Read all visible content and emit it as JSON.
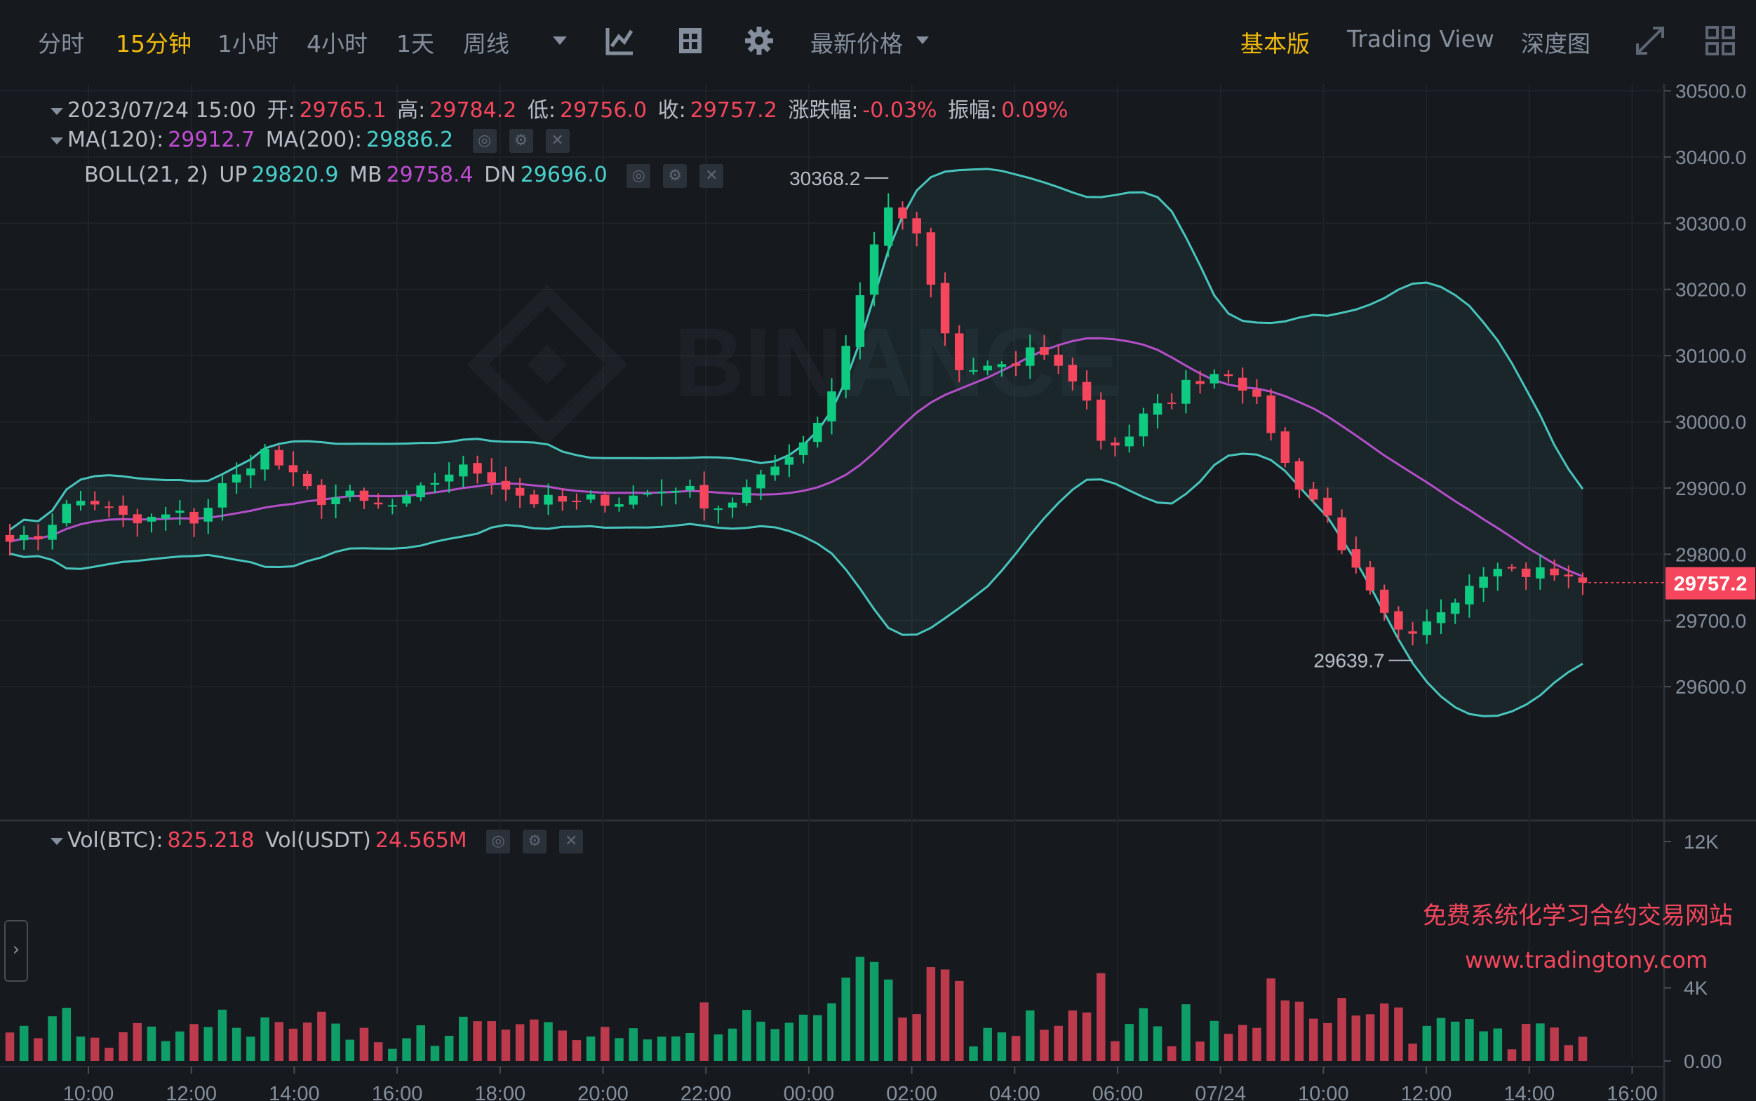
{
  "toolbar": {
    "intervals": [
      "分时",
      "15分钟",
      "1小时",
      "4小时",
      "1天",
      "周线"
    ],
    "active_interval": "15分钟",
    "price_type": "最新价格",
    "views": [
      "基本版",
      "Trading View",
      "深度图"
    ],
    "active_view": "基本版"
  },
  "legend": {
    "ohlc": {
      "time": "2023/07/24 15:00",
      "open_label": "开:",
      "open": "29765.1",
      "high_label": "高:",
      "high": "29784.2",
      "low_label": "低:",
      "low": "29756.0",
      "close_label": "收:",
      "close": "29757.2",
      "change_label": "涨跌幅:",
      "change": "-0.03%",
      "amp_label": "振幅:",
      "amp": "0.09%"
    },
    "ma": {
      "ma120_label": "MA(120):",
      "ma120": "29912.7",
      "ma200_label": "MA(200):",
      "ma200": "29886.2"
    },
    "boll": {
      "label": "BOLL(21, 2)",
      "up_label": "UP",
      "up": "29820.9",
      "mb_label": "MB",
      "mb": "29758.4",
      "dn_label": "DN",
      "dn": "29696.0"
    },
    "vol": {
      "btc_label": "Vol(BTC):",
      "btc": "825.218",
      "usdt_label": "Vol(USDT)",
      "usdt": "24.565M"
    }
  },
  "watermark": {
    "logo_text": "BINANCE",
    "line1": "免费系统化学习合约交易网站",
    "line2": "www.tradingtony.com"
  },
  "colors": {
    "up": "#0ecb81",
    "down": "#f6465d",
    "boll": "#48c5bd",
    "ma": "#b44fc9",
    "accent": "#f0b90b",
    "bg": "#161a1e"
  },
  "chart_data": {
    "type": "candlestick",
    "interval": "15m",
    "price_axis": {
      "ticks": [
        "30500.0",
        "30400.0",
        "30300.0",
        "30200.0",
        "30100.0",
        "30000.0",
        "29900.0",
        "29800.0",
        "29700.0",
        "29600.0"
      ],
      "ylim": [
        29525,
        30510
      ]
    },
    "volume_axis": {
      "ticks": [
        "12K",
        "4K",
        "0.00"
      ],
      "ylim": [
        0,
        12000
      ]
    },
    "time_axis": {
      "ticks": [
        "10:00",
        "12:00",
        "14:00",
        "16:00",
        "18:00",
        "20:00",
        "22:00",
        "00:00",
        "02:00",
        "04:00",
        "06:00",
        "07/24",
        "10:00",
        "12:00",
        "14:00",
        "16:00"
      ]
    },
    "last_price": "29757.2",
    "annotations": [
      {
        "label": "30368.2",
        "value": 30368.2
      },
      {
        "label": "29639.7",
        "value": 29639.7
      }
    ],
    "key_points": {
      "close": [
        29830,
        29815,
        29850,
        29880,
        29880,
        29860,
        29845,
        29855,
        29860,
        29850,
        29900,
        29920,
        29960,
        29930,
        29900,
        29880,
        29890,
        29875,
        29870,
        29880,
        29905,
        29925,
        29930,
        29915,
        29895,
        29880,
        29880,
        29875,
        29885,
        29880,
        29890,
        29895,
        29905,
        29880,
        29870,
        29895,
        29915,
        29950,
        29975,
        30030,
        30130,
        30250,
        30330,
        30300,
        30200,
        30075,
        30075,
        30090,
        30080,
        30115,
        30080,
        30060,
        29975,
        29965,
        30005,
        30025,
        30055,
        30070,
        30080,
        30050,
        30000,
        29920,
        29890,
        29850,
        29780,
        29730,
        29680,
        29670,
        29710,
        29740,
        29770,
        29790,
        29770,
        29775,
        29765,
        29757
      ]
    }
  }
}
